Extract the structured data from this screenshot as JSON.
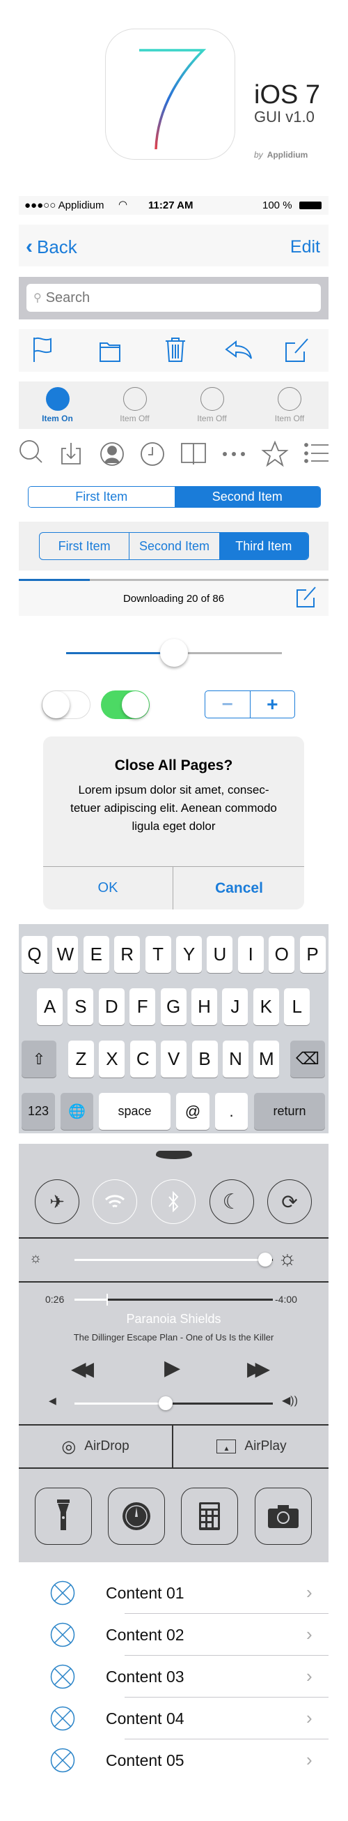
{
  "header": {
    "title": "iOS 7",
    "subtitle": "GUI v1.0",
    "by": "by",
    "brand": "Applidium"
  },
  "status_bar": {
    "carrier": "●●●○○ Applidium",
    "time": "11:27 AM",
    "battery": "100 %"
  },
  "nav_bar": {
    "back_label": "Back",
    "edit_label": "Edit"
  },
  "search": {
    "placeholder": "Search"
  },
  "toolbar": {
    "icons": [
      "flag-icon",
      "folder-icon",
      "trash-icon",
      "reply-icon",
      "compose-icon"
    ]
  },
  "tab_bar": {
    "items": [
      {
        "label": "Item On",
        "active": true
      },
      {
        "label": "Item Off",
        "active": false
      },
      {
        "label": "Item Off",
        "active": false
      },
      {
        "label": "Item Off",
        "active": false
      }
    ]
  },
  "icon_row": [
    "search-icon",
    "download-icon",
    "contact-icon",
    "clock-icon",
    "book-icon",
    "more-icon",
    "star-icon",
    "list-icon"
  ],
  "segmented1": {
    "items": [
      "First Item",
      "Second Item"
    ],
    "selected": 1
  },
  "segmented2": {
    "items": [
      "First Item",
      "Second Item",
      "Third Item"
    ],
    "selected": 2
  },
  "download": {
    "label": "Downloading 20 of 86",
    "progress": 0.23
  },
  "slider": {
    "value": 0.5
  },
  "toggles": [
    {
      "on": false
    },
    {
      "on": true
    }
  ],
  "stepper": {
    "minus": "−",
    "plus": "+"
  },
  "alert": {
    "title": "Close All Pages?",
    "message_lines": [
      "Lorem ipsum dolor sit amet, consec-",
      "tetuer adipiscing elit. Aenean commodo",
      "ligula eget dolor"
    ],
    "ok": "OK",
    "cancel": "Cancel"
  },
  "keyboard": {
    "row1": [
      "Q",
      "W",
      "E",
      "R",
      "T",
      "Y",
      "U",
      "I",
      "O",
      "P"
    ],
    "row2": [
      "A",
      "S",
      "D",
      "F",
      "G",
      "H",
      "J",
      "K",
      "L"
    ],
    "row3": [
      "Z",
      "X",
      "C",
      "V",
      "B",
      "N",
      "M"
    ],
    "numbers": "123",
    "space": "space",
    "at": "@",
    "dot": ".",
    "return": "return"
  },
  "control_center": {
    "brightness": 0.96,
    "elapsed": "0:26",
    "remaining": "-4:00",
    "track_progress": 0.16,
    "song": "Paranoia Shields",
    "artist_album": "The Dillinger Escape Plan - One of Us Is the Killer",
    "volume": 0.46,
    "airdrop": "AirDrop",
    "airplay": "AirPlay"
  },
  "list": {
    "items": [
      "Content 01",
      "Content 02",
      "Content 03",
      "Content 04",
      "Content 05"
    ]
  },
  "colors": {
    "accent": "#1a7cd9",
    "toggle_on": "#4cd964",
    "panel": "#f7f7f7",
    "control_center": "#d2d3d7",
    "keyboard": "#d1d4d9"
  }
}
